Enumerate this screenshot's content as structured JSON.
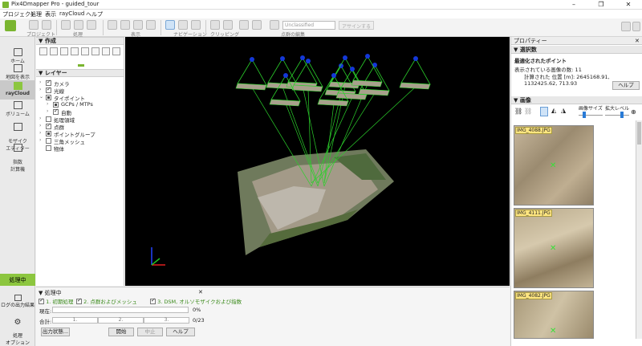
{
  "window": {
    "title": "Pix4Dmapper Pro - guided_tour"
  },
  "menu": [
    "プロジェクト",
    "処理",
    "表示",
    "rayCloud",
    "ヘルプ"
  ],
  "toolbar": {
    "groups": [
      "プロジェクト",
      "処理",
      "表示",
      "ナビゲーション",
      "クリッピング",
      "点群の編集"
    ],
    "class_combo": "Unclassified",
    "assign_button": "アサインする"
  },
  "leftnav": {
    "items": [
      {
        "label": "ホーム"
      },
      {
        "label": "地図を表示"
      },
      {
        "label": "rayCloud"
      },
      {
        "label": "ボリューム"
      },
      {
        "label": "モザイク\nエディター"
      },
      {
        "label": "指数\n計算機"
      }
    ],
    "processing_label": "処理中",
    "log_label": "ログの出力結果",
    "options_label": "処理\nオプション"
  },
  "left_panel": {
    "create_title": "作成",
    "layers_title": "レイヤー",
    "layers": [
      {
        "label": "カメラ",
        "state": "on",
        "indent": 0,
        "arrow": "›"
      },
      {
        "label": "光線",
        "state": "on",
        "indent": 0,
        "arrow": "›"
      },
      {
        "label": "タイポイント",
        "state": "partial",
        "indent": 0,
        "arrow": "⌄"
      },
      {
        "label": "GCPs / MTPs",
        "state": "partial",
        "indent": 1,
        "arrow": "›"
      },
      {
        "label": "自動",
        "state": "on",
        "indent": 1,
        "arrow": "›"
      },
      {
        "label": "処理領域",
        "state": "off",
        "indent": 0,
        "arrow": "›"
      },
      {
        "label": "点群",
        "state": "on",
        "indent": 0,
        "arrow": "›"
      },
      {
        "label": "ポイントグループ",
        "state": "partial",
        "indent": 0,
        "arrow": "›"
      },
      {
        "label": "三角メッシュ",
        "state": "off",
        "indent": 0,
        "arrow": "›"
      },
      {
        "label": "物体",
        "state": "off",
        "indent": 0,
        "arrow": ""
      }
    ]
  },
  "right_panel": {
    "properties_title": "プロパティー",
    "selection_title": "選択数",
    "selected_point": "最適化されたポイント",
    "images_count_label": "表示されている画像の数: 11",
    "position_label": "計算された 位置 [m]: 2645168.91, 1132425.62, 713.93",
    "help_button": "ヘルプ",
    "images_title": "画像",
    "image_size_label": "画像サイズ",
    "zoom_label": "拡大レベル",
    "thumbnails": [
      "IMG_4088.JPG",
      "IMG_4111.JPG",
      "IMG_4082.JPG"
    ]
  },
  "bottom": {
    "title": "処理中",
    "steps": [
      "1. 初期処理",
      "2. 点群およびメッシュ",
      "3. DSM, オルソモザイクおよび指数"
    ],
    "current_label": "現在:",
    "current_pct": "0%",
    "total_label": "合計:",
    "total_steps": [
      "1.",
      "2.",
      "3."
    ],
    "total_count": "0/23",
    "output_button": "出力状態...",
    "start_button": "開始",
    "stop_button": "中止",
    "help_button": "ヘルプ"
  },
  "colors": {
    "accent": "#8cc63f",
    "point": "#1438d8",
    "ray": "#2bd02b"
  }
}
